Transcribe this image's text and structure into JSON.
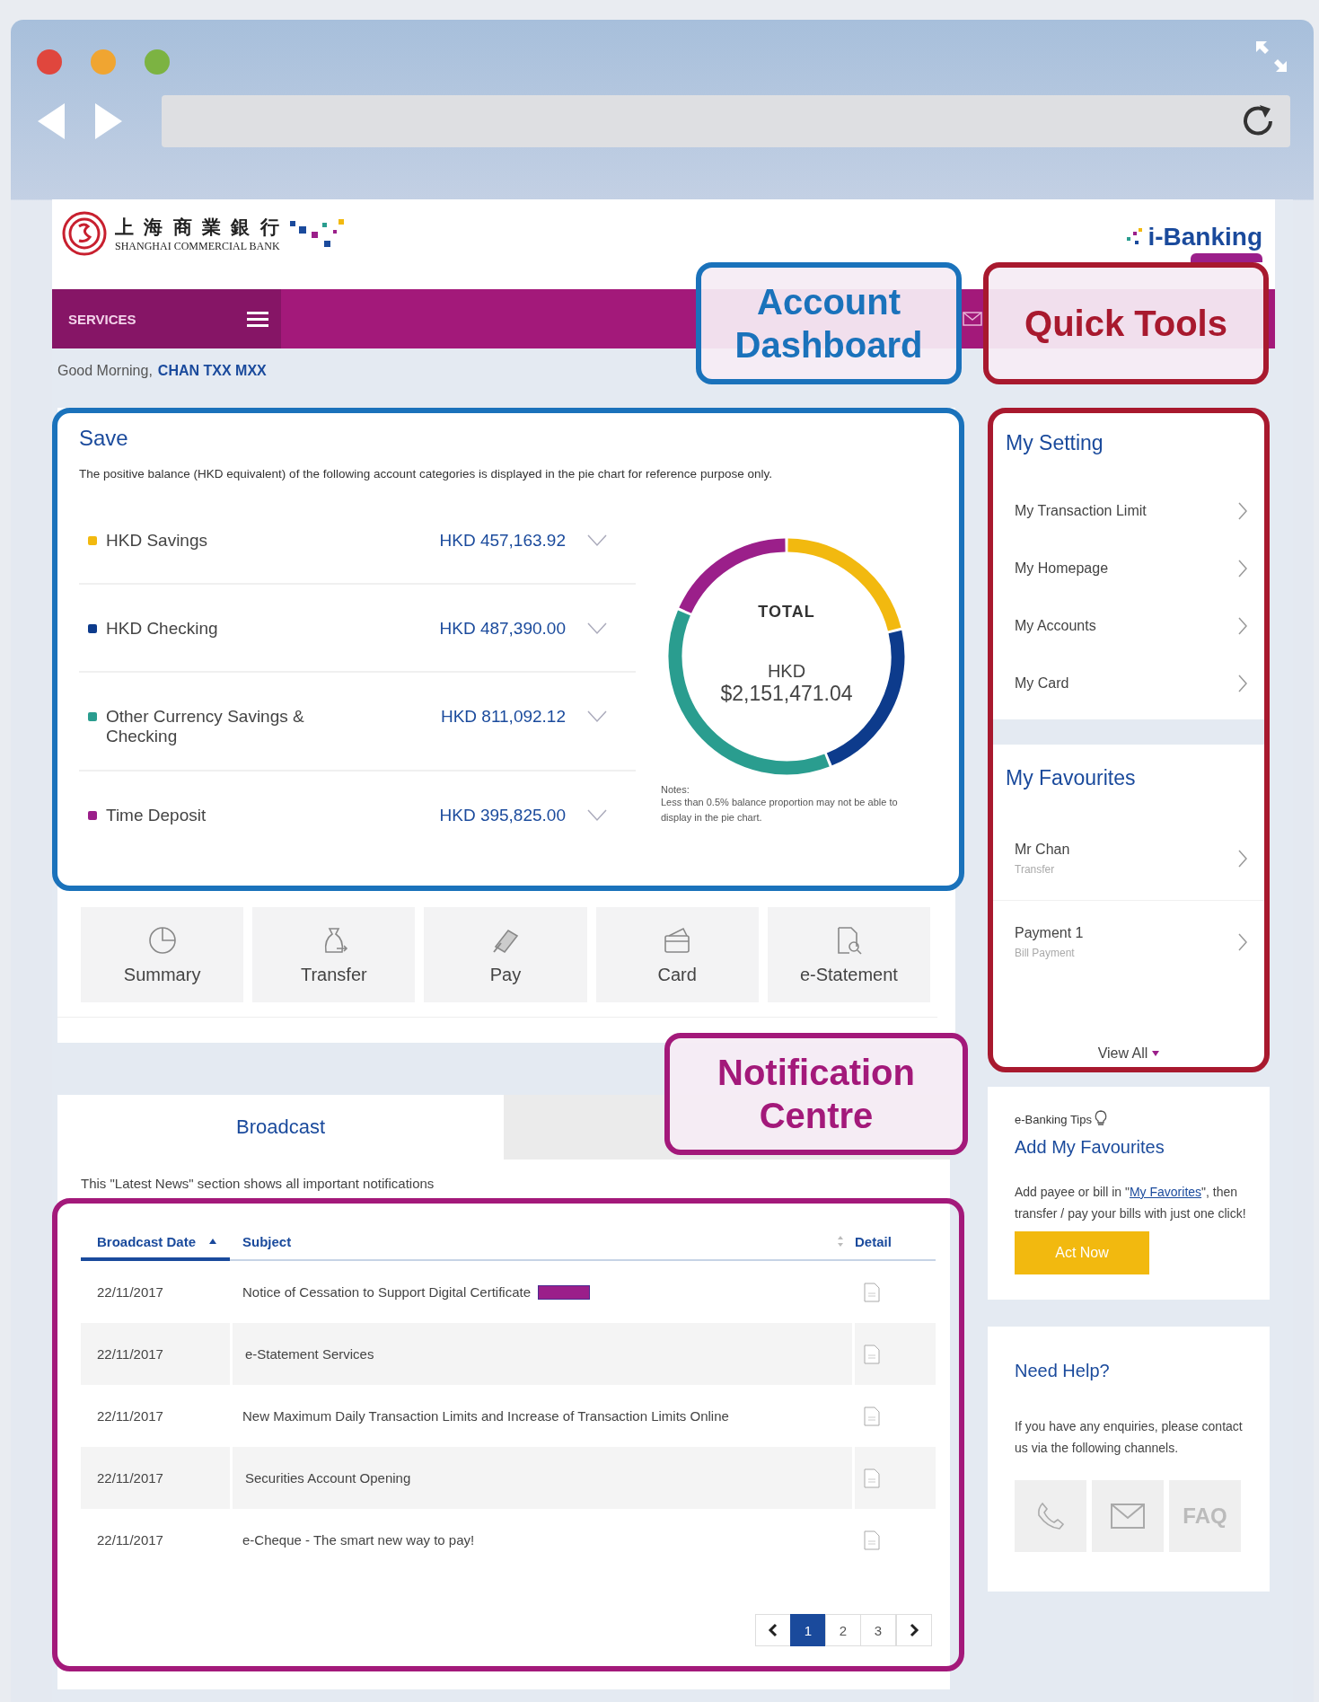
{
  "header": {
    "bank_name_chinese": "上 海 商 業 銀 行",
    "bank_name": "SHANGHAI COMMERCIAL BANK",
    "product": "i-Banking"
  },
  "navbar": {
    "services": "SERVICES"
  },
  "greeting": {
    "text": "Good Morning,",
    "name": "CHAN TXX MXX"
  },
  "save": {
    "title": "Save",
    "description": "The positive balance (HKD equivalent) of the following account categories is displayed in the pie chart for reference purpose only.",
    "accounts": [
      {
        "name": "HKD Savings",
        "amount": "HKD 457,163.92",
        "color": "#f2b90f",
        "expanded": false
      },
      {
        "name": "HKD Checking",
        "amount": "HKD 487,390.00",
        "color": "#0d3b8c",
        "expanded": false
      },
      {
        "name": "Other Currency Savings & Checking",
        "amount": "HKD 811,092.12",
        "color": "#2a9d8f",
        "expanded": false
      },
      {
        "name": "Time Deposit",
        "amount": "HKD 395,825.00",
        "color": "#9b1f8a",
        "expanded": false
      }
    ],
    "total_label": "TOTAL",
    "total_currency": "HKD",
    "total_amount": "$2,151,471.04",
    "notes_title": "Notes:",
    "notes": "Less than 0.5% balance proportion may not be able to display in the pie chart."
  },
  "shortcuts": [
    {
      "kind": "summary",
      "label": "Summary"
    },
    {
      "kind": "transfer",
      "label": "Transfer"
    },
    {
      "kind": "pay",
      "label": "Pay"
    },
    {
      "kind": "card",
      "label": "Card"
    },
    {
      "kind": "statement",
      "label": "e-Statement"
    }
  ],
  "notifications": {
    "tabs": [
      {
        "label": "Broadcast",
        "selected": true
      },
      {
        "selected": false
      }
    ],
    "intro": "This \"Latest News\" section shows all important notifications",
    "columns": [
      {
        "label": "Broadcast Date",
        "sortable": true,
        "sorted": true
      },
      {
        "label": "Subject",
        "sortable": true,
        "sorted": false
      },
      {
        "label": "Detail",
        "sortable": false,
        "sorted": false
      }
    ],
    "rows": [
      {
        "date": "22/11/2017",
        "subject": "Notice of Cessation to Support Digital Certificate",
        "important": true
      },
      {
        "date": "22/11/2017",
        "subject": "e-Statement Services",
        "important": false
      },
      {
        "date": "22/11/2017",
        "subject": "New Maximum Daily Transaction Limits and Increase of Transaction Limits Online",
        "important": false
      },
      {
        "date": "22/11/2017",
        "subject": "Securities Account Opening",
        "important": false
      },
      {
        "date": "22/11/2017",
        "subject": "e-Cheque - The smart new way to pay!",
        "important": false
      }
    ],
    "pages": [
      {
        "label": "1",
        "selected": true
      },
      {
        "label": "2",
        "selected": false
      },
      {
        "label": "3",
        "selected": false
      }
    ]
  },
  "quick_tools": {
    "setting_title": "My Setting",
    "settings": [
      "My Transaction Limit",
      "My Homepage",
      "My Accounts",
      "My Card"
    ],
    "favourites_title": "My Favourites",
    "favourites": [
      {
        "name": "Mr Chan",
        "type": "Transfer"
      },
      {
        "name": "Payment 1",
        "type": "Bill Payment"
      }
    ],
    "view_all": "View All"
  },
  "tips": {
    "label": "e-Banking Tips",
    "title": "Add My Favourites",
    "text_before": "Add payee or bill in \"",
    "link": "My Favorites",
    "text_after": "\", then transfer / pay your bills with just one click!",
    "button": "Act Now"
  },
  "help": {
    "title": "Need Help?",
    "text": "If you have any enquiries, please contact us via the following channels.",
    "channels": [
      {
        "kind": "phone"
      },
      {
        "kind": "email"
      },
      {
        "kind": "faq",
        "label": "FAQ"
      }
    ]
  },
  "callouts": [
    {
      "label": "Account Dashboard",
      "color": "#1a72bb"
    },
    {
      "label": "Quick Tools",
      "color": "#a8192e"
    },
    {
      "label": "Notification Centre",
      "color": "#a3197a"
    }
  ]
}
